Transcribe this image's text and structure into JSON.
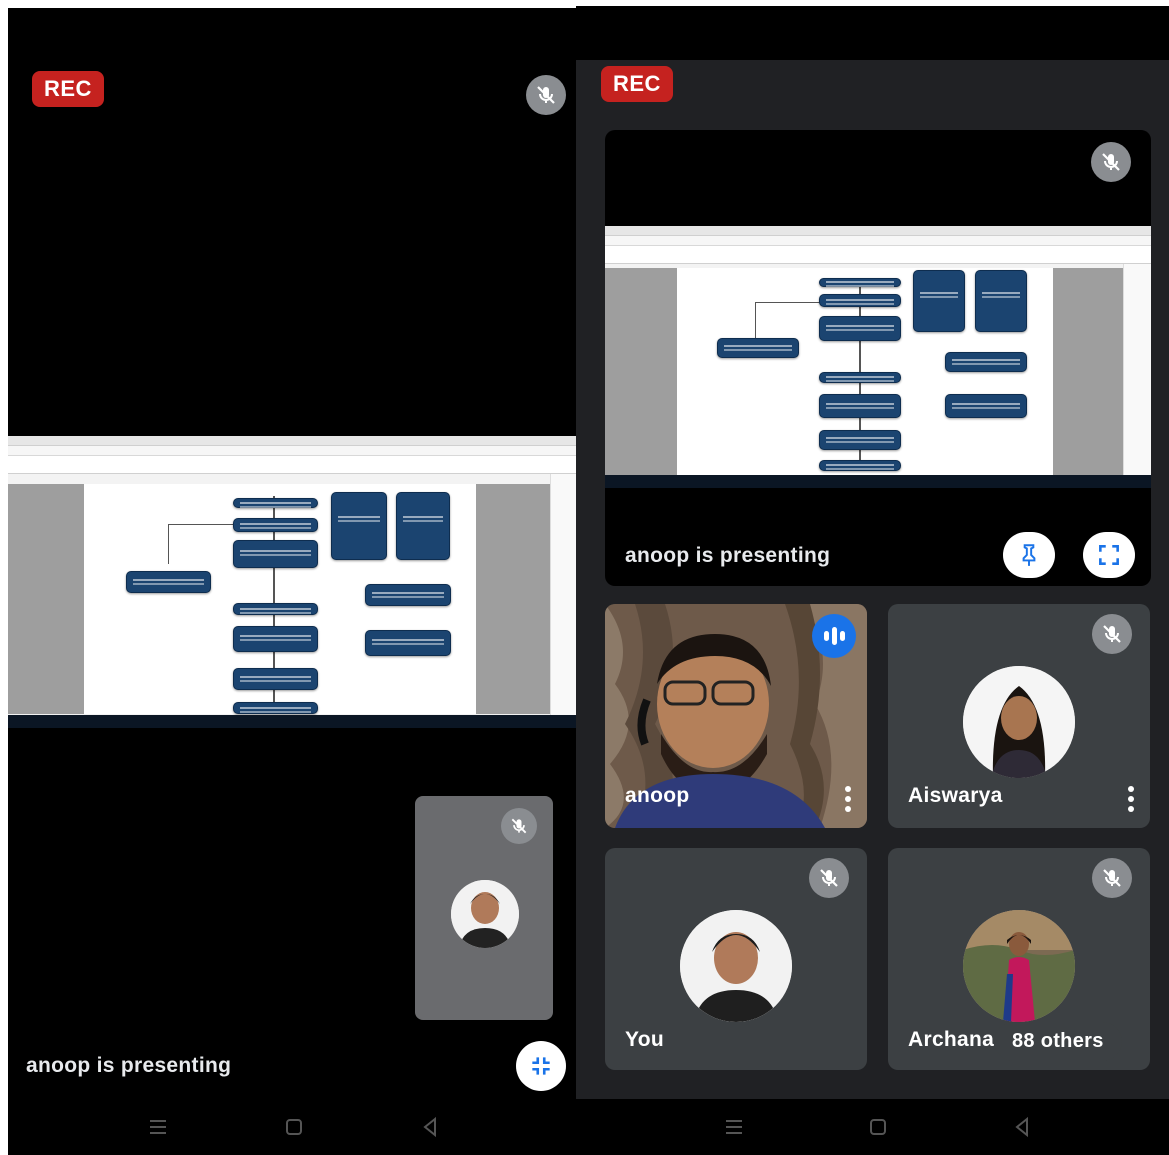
{
  "left_screen": {
    "rec_label": "REC",
    "presenting_text": "anoop is presenting"
  },
  "right_screen": {
    "rec_label": "REC",
    "presenting_text": "anoop is presenting",
    "participants": [
      {
        "name": "anoop",
        "status": "speaking"
      },
      {
        "name": "Aiswarya",
        "status": "muted"
      },
      {
        "name": "You",
        "status": "muted"
      },
      {
        "name": "Archana",
        "status": "muted"
      }
    ],
    "others_label": "88 others"
  },
  "icons": {
    "mic_off": "mic-off-icon",
    "pin": "pin-icon",
    "fullscreen": "fullscreen-icon",
    "exit_fullscreen": "exit-fullscreen-icon",
    "more": "more-vert-icon",
    "nav_recents": "recents-icon",
    "nav_home": "home-icon",
    "nav_back": "back-icon"
  },
  "colors": {
    "rec": "#c5221f",
    "tile": "#3c4043",
    "meet_bg": "#202124",
    "speaking": "#1a73e8"
  }
}
